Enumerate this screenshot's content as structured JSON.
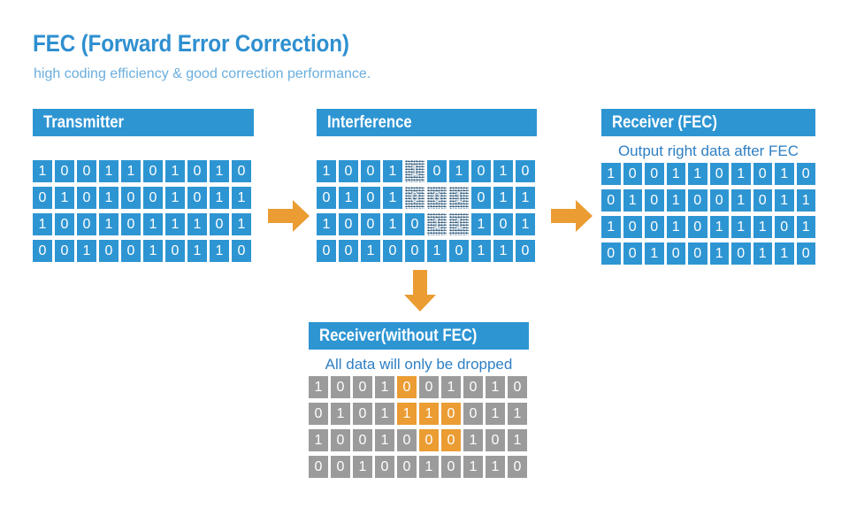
{
  "title": "FEC (Forward Error Correction)",
  "subtitle": "high coding efficiency & good correction performance.",
  "colors": {
    "brand_blue": "#2e95d3",
    "title_blue": "#2f8fd0",
    "subtitle_blue": "#6aaedd",
    "caption_blue": "#2e7fc4",
    "arrow_orange": "#eb9c33",
    "bit_gray": "#9b9b9b",
    "bit_orange": "#eb9c33"
  },
  "panels": {
    "transmitter": {
      "header": "Transmitter",
      "caption": "",
      "rows": [
        [
          {
            "v": "1",
            "s": "blue"
          },
          {
            "v": "0",
            "s": "blue"
          },
          {
            "v": "0",
            "s": "blue"
          },
          {
            "v": "1",
            "s": "blue"
          },
          {
            "v": "1",
            "s": "blue"
          },
          {
            "v": "0",
            "s": "blue"
          },
          {
            "v": "1",
            "s": "blue"
          },
          {
            "v": "0",
            "s": "blue"
          },
          {
            "v": "1",
            "s": "blue"
          },
          {
            "v": "0",
            "s": "blue"
          }
        ],
        [
          {
            "v": "0",
            "s": "blue"
          },
          {
            "v": "1",
            "s": "blue"
          },
          {
            "v": "0",
            "s": "blue"
          },
          {
            "v": "1",
            "s": "blue"
          },
          {
            "v": "0",
            "s": "blue"
          },
          {
            "v": "0",
            "s": "blue"
          },
          {
            "v": "1",
            "s": "blue"
          },
          {
            "v": "0",
            "s": "blue"
          },
          {
            "v": "1",
            "s": "blue"
          },
          {
            "v": "1",
            "s": "blue"
          }
        ],
        [
          {
            "v": "1",
            "s": "blue"
          },
          {
            "v": "0",
            "s": "blue"
          },
          {
            "v": "0",
            "s": "blue"
          },
          {
            "v": "1",
            "s": "blue"
          },
          {
            "v": "0",
            "s": "blue"
          },
          {
            "v": "1",
            "s": "blue"
          },
          {
            "v": "1",
            "s": "blue"
          },
          {
            "v": "1",
            "s": "blue"
          },
          {
            "v": "0",
            "s": "blue"
          },
          {
            "v": "1",
            "s": "blue"
          }
        ],
        [
          {
            "v": "0",
            "s": "blue"
          },
          {
            "v": "0",
            "s": "blue"
          },
          {
            "v": "1",
            "s": "blue"
          },
          {
            "v": "0",
            "s": "blue"
          },
          {
            "v": "0",
            "s": "blue"
          },
          {
            "v": "1",
            "s": "blue"
          },
          {
            "v": "0",
            "s": "blue"
          },
          {
            "v": "1",
            "s": "blue"
          },
          {
            "v": "1",
            "s": "blue"
          },
          {
            "v": "0",
            "s": "blue"
          }
        ]
      ]
    },
    "interference": {
      "header": "Interference",
      "caption": "",
      "rows": [
        [
          {
            "v": "1",
            "s": "blue"
          },
          {
            "v": "0",
            "s": "blue"
          },
          {
            "v": "0",
            "s": "blue"
          },
          {
            "v": "1",
            "s": "blue"
          },
          {
            "v": "1",
            "s": "noise"
          },
          {
            "v": "0",
            "s": "blue"
          },
          {
            "v": "1",
            "s": "blue"
          },
          {
            "v": "0",
            "s": "blue"
          },
          {
            "v": "1",
            "s": "blue"
          },
          {
            "v": "0",
            "s": "blue"
          }
        ],
        [
          {
            "v": "0",
            "s": "blue"
          },
          {
            "v": "1",
            "s": "blue"
          },
          {
            "v": "0",
            "s": "blue"
          },
          {
            "v": "1",
            "s": "blue"
          },
          {
            "v": "0",
            "s": "noise"
          },
          {
            "v": "0",
            "s": "noise"
          },
          {
            "v": "1",
            "s": "noise"
          },
          {
            "v": "0",
            "s": "blue"
          },
          {
            "v": "1",
            "s": "blue"
          },
          {
            "v": "1",
            "s": "blue"
          }
        ],
        [
          {
            "v": "1",
            "s": "blue"
          },
          {
            "v": "0",
            "s": "blue"
          },
          {
            "v": "0",
            "s": "blue"
          },
          {
            "v": "1",
            "s": "blue"
          },
          {
            "v": "0",
            "s": "blue"
          },
          {
            "v": "1",
            "s": "noise"
          },
          {
            "v": "1",
            "s": "noise"
          },
          {
            "v": "1",
            "s": "blue"
          },
          {
            "v": "0",
            "s": "blue"
          },
          {
            "v": "1",
            "s": "blue"
          }
        ],
        [
          {
            "v": "0",
            "s": "blue"
          },
          {
            "v": "0",
            "s": "blue"
          },
          {
            "v": "1",
            "s": "blue"
          },
          {
            "v": "0",
            "s": "blue"
          },
          {
            "v": "0",
            "s": "blue"
          },
          {
            "v": "1",
            "s": "blue"
          },
          {
            "v": "0",
            "s": "blue"
          },
          {
            "v": "1",
            "s": "blue"
          },
          {
            "v": "1",
            "s": "blue"
          },
          {
            "v": "0",
            "s": "blue"
          }
        ]
      ]
    },
    "receiver_fec": {
      "header": "Receiver (FEC)",
      "caption": "Output right data after FEC",
      "rows": [
        [
          {
            "v": "1",
            "s": "blue"
          },
          {
            "v": "0",
            "s": "blue"
          },
          {
            "v": "0",
            "s": "blue"
          },
          {
            "v": "1",
            "s": "blue"
          },
          {
            "v": "1",
            "s": "blue"
          },
          {
            "v": "0",
            "s": "blue"
          },
          {
            "v": "1",
            "s": "blue"
          },
          {
            "v": "0",
            "s": "blue"
          },
          {
            "v": "1",
            "s": "blue"
          },
          {
            "v": "0",
            "s": "blue"
          }
        ],
        [
          {
            "v": "0",
            "s": "blue"
          },
          {
            "v": "1",
            "s": "blue"
          },
          {
            "v": "0",
            "s": "blue"
          },
          {
            "v": "1",
            "s": "blue"
          },
          {
            "v": "0",
            "s": "blue"
          },
          {
            "v": "0",
            "s": "blue"
          },
          {
            "v": "1",
            "s": "blue"
          },
          {
            "v": "0",
            "s": "blue"
          },
          {
            "v": "1",
            "s": "blue"
          },
          {
            "v": "1",
            "s": "blue"
          }
        ],
        [
          {
            "v": "1",
            "s": "blue"
          },
          {
            "v": "0",
            "s": "blue"
          },
          {
            "v": "0",
            "s": "blue"
          },
          {
            "v": "1",
            "s": "blue"
          },
          {
            "v": "0",
            "s": "blue"
          },
          {
            "v": "1",
            "s": "blue"
          },
          {
            "v": "1",
            "s": "blue"
          },
          {
            "v": "1",
            "s": "blue"
          },
          {
            "v": "0",
            "s": "blue"
          },
          {
            "v": "1",
            "s": "blue"
          }
        ],
        [
          {
            "v": "0",
            "s": "blue"
          },
          {
            "v": "0",
            "s": "blue"
          },
          {
            "v": "1",
            "s": "blue"
          },
          {
            "v": "0",
            "s": "blue"
          },
          {
            "v": "0",
            "s": "blue"
          },
          {
            "v": "1",
            "s": "blue"
          },
          {
            "v": "0",
            "s": "blue"
          },
          {
            "v": "1",
            "s": "blue"
          },
          {
            "v": "1",
            "s": "blue"
          },
          {
            "v": "0",
            "s": "blue"
          }
        ]
      ]
    },
    "receiver_no_fec": {
      "header": "Receiver(without FEC)",
      "caption": "All data will only be dropped",
      "rows": [
        [
          {
            "v": "1",
            "s": "gray"
          },
          {
            "v": "0",
            "s": "gray"
          },
          {
            "v": "0",
            "s": "gray"
          },
          {
            "v": "1",
            "s": "gray"
          },
          {
            "v": "0",
            "s": "orange"
          },
          {
            "v": "0",
            "s": "gray"
          },
          {
            "v": "1",
            "s": "gray"
          },
          {
            "v": "0",
            "s": "gray"
          },
          {
            "v": "1",
            "s": "gray"
          },
          {
            "v": "0",
            "s": "gray"
          }
        ],
        [
          {
            "v": "0",
            "s": "gray"
          },
          {
            "v": "1",
            "s": "gray"
          },
          {
            "v": "0",
            "s": "gray"
          },
          {
            "v": "1",
            "s": "gray"
          },
          {
            "v": "1",
            "s": "orange"
          },
          {
            "v": "1",
            "s": "orange"
          },
          {
            "v": "0",
            "s": "orange"
          },
          {
            "v": "0",
            "s": "gray"
          },
          {
            "v": "1",
            "s": "gray"
          },
          {
            "v": "1",
            "s": "gray"
          }
        ],
        [
          {
            "v": "1",
            "s": "gray"
          },
          {
            "v": "0",
            "s": "gray"
          },
          {
            "v": "0",
            "s": "gray"
          },
          {
            "v": "1",
            "s": "gray"
          },
          {
            "v": "0",
            "s": "gray"
          },
          {
            "v": "0",
            "s": "orange"
          },
          {
            "v": "0",
            "s": "orange"
          },
          {
            "v": "1",
            "s": "gray"
          },
          {
            "v": "0",
            "s": "gray"
          },
          {
            "v": "1",
            "s": "gray"
          }
        ],
        [
          {
            "v": "0",
            "s": "gray"
          },
          {
            "v": "0",
            "s": "gray"
          },
          {
            "v": "1",
            "s": "gray"
          },
          {
            "v": "0",
            "s": "gray"
          },
          {
            "v": "0",
            "s": "gray"
          },
          {
            "v": "1",
            "s": "gray"
          },
          {
            "v": "0",
            "s": "gray"
          },
          {
            "v": "1",
            "s": "gray"
          },
          {
            "v": "1",
            "s": "gray"
          },
          {
            "v": "0",
            "s": "gray"
          }
        ]
      ]
    }
  },
  "arrows": [
    {
      "name": "arrow-transmitter-to-interference",
      "dir": "right"
    },
    {
      "name": "arrow-interference-to-receiver-fec",
      "dir": "right"
    },
    {
      "name": "arrow-interference-to-receiver-no-fec",
      "dir": "down"
    }
  ]
}
